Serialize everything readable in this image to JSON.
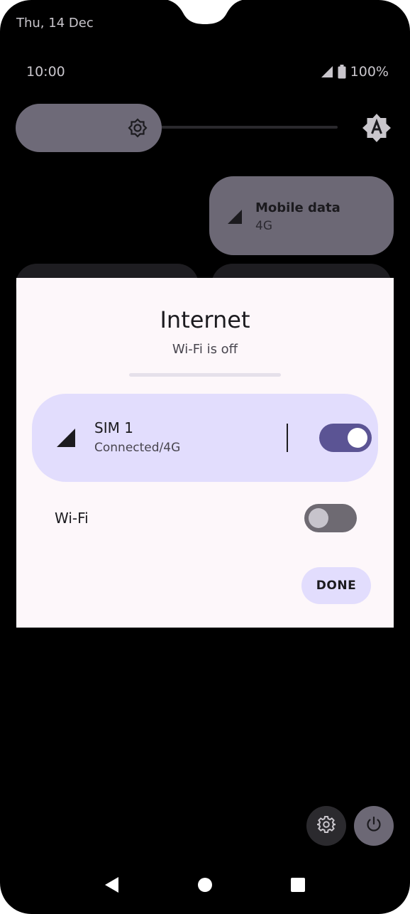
{
  "status_bar": {
    "date": "Thu, 14 Dec",
    "time": "10:00",
    "battery": "100%"
  },
  "quick_settings": {
    "mobile_tile": {
      "title": "Mobile data",
      "subtitle": "4G"
    }
  },
  "dialog": {
    "title": "Internet",
    "subtitle": "Wi-Fi is off",
    "sim": {
      "name": "SIM 1",
      "status": "Connected/4G",
      "enabled": true
    },
    "wifi": {
      "label": "Wi-Fi",
      "enabled": false
    },
    "done_label": "DONE"
  },
  "colors": {
    "accent": "#5b5494",
    "card": "#e2ddfd",
    "dialog_bg": "#fdf7fa",
    "tile": "#6c6875"
  }
}
